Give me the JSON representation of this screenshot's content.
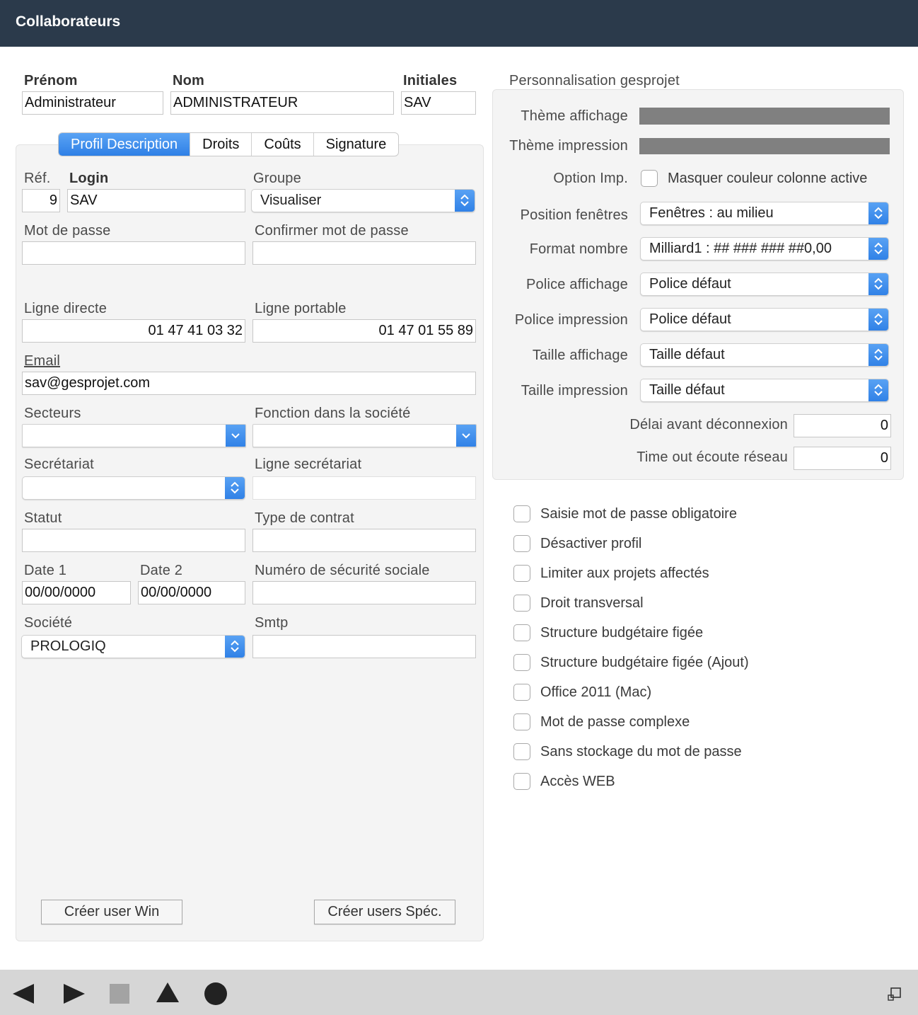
{
  "window": {
    "title": "Collaborateurs"
  },
  "header": {
    "prenom_label": "Prénom",
    "prenom_value": "Administrateur",
    "nom_label": "Nom",
    "nom_value": "ADMINISTRATEUR",
    "initiales_label": "Initiales",
    "initiales_value": "SAV"
  },
  "tabs": [
    {
      "label": "Profil Description",
      "active": true
    },
    {
      "label": "Droits"
    },
    {
      "label": "Coûts"
    },
    {
      "label": "Signature"
    }
  ],
  "profil": {
    "ref_label": "Réf.",
    "ref_value": "9",
    "login_label": "Login",
    "login_value": "SAV",
    "groupe_label": "Groupe",
    "groupe_value": "Visualiser",
    "password_label": "Mot de passe",
    "password_value": "",
    "confirm_label": "Confirmer mot de passe",
    "confirm_value": "",
    "ligne_directe_label": "Ligne directe",
    "ligne_directe_value": "01 47 41 03 32",
    "ligne_portable_label": "Ligne portable",
    "ligne_portable_value": "01 47 01 55 89",
    "email_label": "Email",
    "email_value": "sav@gesprojet.com",
    "secteurs_label": "Secteurs",
    "secteurs_value": "",
    "fonction_label": "Fonction dans la société",
    "fonction_value": "",
    "secretariat_label": "Secrétariat",
    "secretariat_value": "",
    "ligne_secretariat_label": "Ligne secrétariat",
    "ligne_secretariat_value": "",
    "statut_label": "Statut",
    "statut_value": "",
    "contrat_label": "Type de contrat",
    "contrat_value": "",
    "date1_label": "Date 1",
    "date1_value": "00/00/0000",
    "date2_label": "Date 2",
    "date2_value": "00/00/0000",
    "secu_label": "Numéro de sécurité sociale",
    "secu_value": "",
    "societe_label": "Société",
    "societe_value": "PROLOGIQ",
    "smtp_label": "Smtp",
    "smtp_value": "",
    "btn_user_win": "Créer user Win",
    "btn_users_spec": "Créer users Spéc."
  },
  "perso": {
    "title": "Personnalisation gesprojet",
    "theme_affichage_label": "Thème affichage",
    "theme_impression_label": "Thème impression",
    "option_imp_label": "Option Imp.",
    "option_imp_checkbox": "Masquer couleur colonne active",
    "position_label": "Position fenêtres",
    "position_value": "Fenêtres : au milieu",
    "format_label": "Format nombre",
    "format_value": "Milliard1 : ## ### ### ##0,00",
    "police_aff_label": "Police affichage",
    "police_aff_value": "Police défaut",
    "police_imp_label": "Police impression",
    "police_imp_value": "Police défaut",
    "taille_aff_label": "Taille affichage",
    "taille_aff_value": "Taille défaut",
    "taille_imp_label": "Taille impression",
    "taille_imp_value": "Taille défaut",
    "delai_label": "Délai avant déconnexion",
    "delai_value": "0",
    "timeout_label": "Time out écoute réseau",
    "timeout_value": "0",
    "theme_color": "#808080"
  },
  "options": [
    "Saisie mot de passe obligatoire",
    "Désactiver profil",
    "Limiter aux projets affectés",
    "Droit transversal",
    "Structure budgétaire figée",
    "Structure budgétaire figée (Ajout)",
    "Office 2011 (Mac)",
    "Mot de passe complexe",
    "Sans stockage du mot de passe",
    "Accès WEB"
  ],
  "toolbar": {
    "icons": [
      "previous-icon",
      "next-icon",
      "stop-icon",
      "triangle-icon",
      "circle-icon",
      "window-resize-icon"
    ]
  },
  "colors": {
    "titlebar": "#2b3a4b",
    "accent": "#3a8bec"
  }
}
